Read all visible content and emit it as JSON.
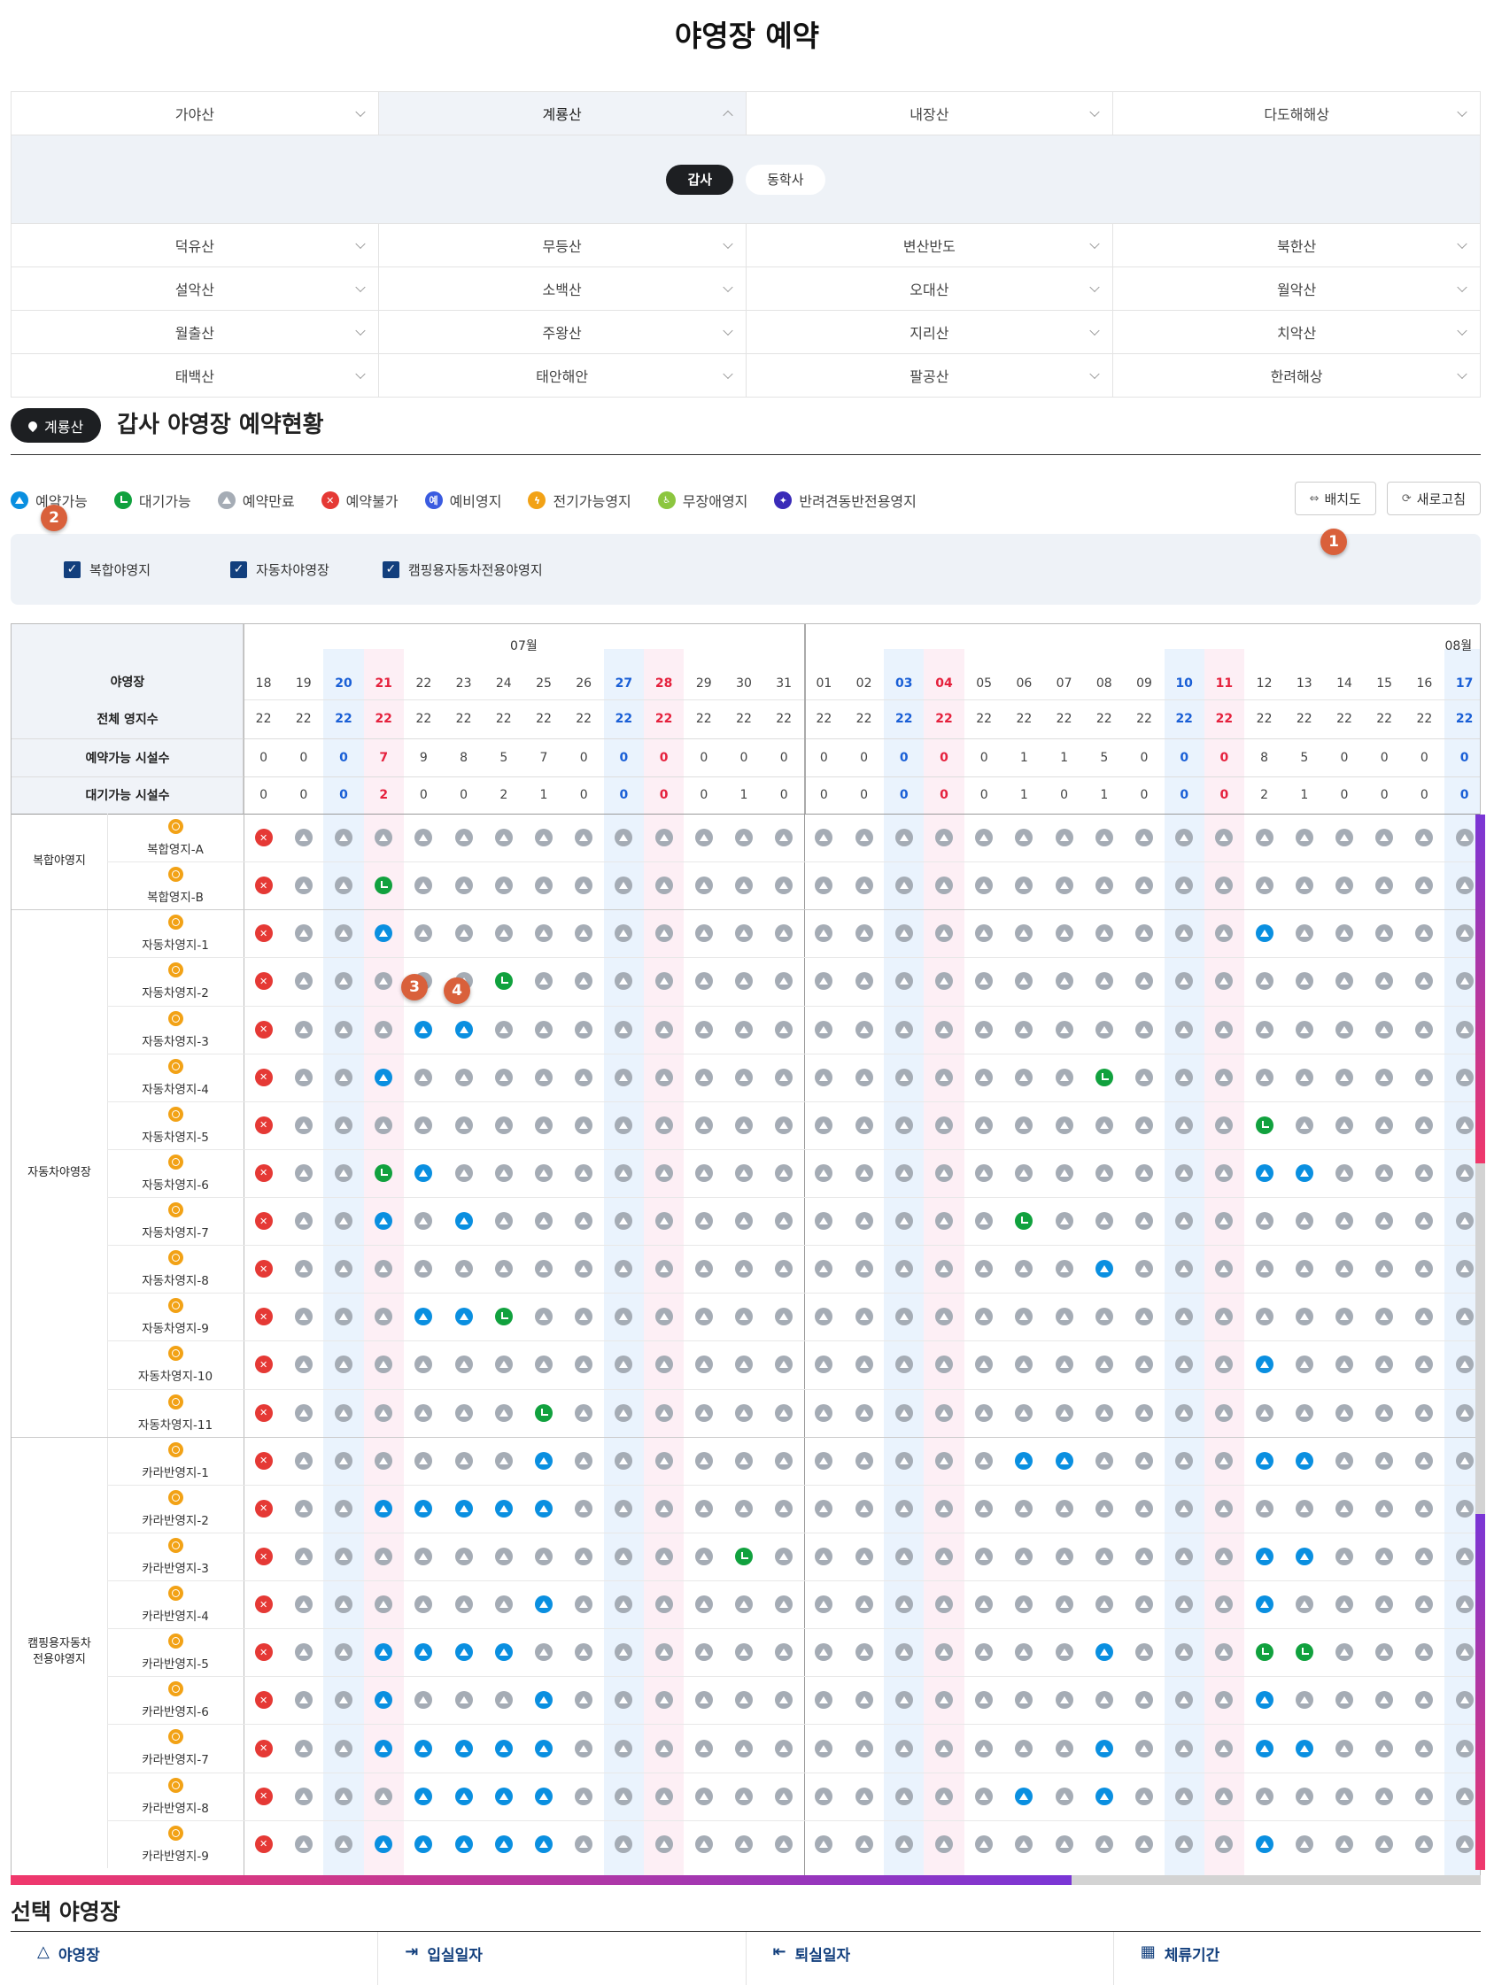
{
  "page_title": "야영장 예약",
  "mountains": [
    [
      "가야산",
      "계룡산",
      "내장산",
      "다도해해상"
    ],
    [
      "덕유산",
      "무등산",
      "변산반도",
      "북한산"
    ],
    [
      "설악산",
      "소백산",
      "오대산",
      "월악산"
    ],
    [
      "월출산",
      "주왕산",
      "지리산",
      "치악산"
    ],
    [
      "태백산",
      "태안해안",
      "팔공산",
      "한려해상"
    ]
  ],
  "active_mountain": "계룡산",
  "sub_sites": [
    "갑사",
    "동학사"
  ],
  "active_sub": "갑사",
  "section": {
    "location": "계룡산",
    "title": "갑사 야영장 예약현황"
  },
  "legend": [
    {
      "label": "예약가능",
      "icon": "available-triangle-icon",
      "color": "#0a8fe0"
    },
    {
      "label": "대기가능",
      "icon": "waiting-clock-icon",
      "color": "#11a13e"
    },
    {
      "label": "예약만료",
      "icon": "expired-triangle-icon",
      "color": "#a5acb5"
    },
    {
      "label": "예약불가",
      "icon": "unavailable-x-icon",
      "color": "#e53935"
    },
    {
      "label": "예비영지",
      "icon": "reserve-icon",
      "color": "#3a5be0",
      "glyph": "예"
    },
    {
      "label": "전기가능영지",
      "icon": "electric-icon",
      "color": "#f2a216"
    },
    {
      "label": "무장애영지",
      "icon": "accessible-icon",
      "color": "#8cc63f"
    },
    {
      "label": "반려견동반전용영지",
      "icon": "pet-icon",
      "color": "#3a2bb8"
    }
  ],
  "buttons": {
    "map": "배치도",
    "refresh": "새로고침"
  },
  "filters": [
    "복합야영지",
    "자동차야영장",
    "캠핑용자동차전용야영지"
  ],
  "markers": [
    "1",
    "2",
    "3",
    "4"
  ],
  "table": {
    "corner": "야영장",
    "months": [
      {
        "label": "07월",
        "span": 14
      },
      {
        "label": "08월",
        "span": 17
      }
    ],
    "days": [
      "18",
      "19",
      "20",
      "21",
      "22",
      "23",
      "24",
      "25",
      "26",
      "27",
      "28",
      "29",
      "30",
      "31",
      "01",
      "02",
      "03",
      "04",
      "05",
      "06",
      "07",
      "08",
      "09",
      "10",
      "11",
      "12",
      "13",
      "14",
      "15",
      "16",
      "17"
    ],
    "day_types": [
      "w",
      "w",
      "sat",
      "sun",
      "w",
      "w",
      "w",
      "w",
      "w",
      "sat",
      "sun",
      "w",
      "w",
      "w",
      "w",
      "w",
      "sat",
      "sun",
      "w",
      "w",
      "w",
      "w",
      "w",
      "sat",
      "sun",
      "w",
      "w",
      "w",
      "w",
      "w",
      "sat"
    ],
    "summary_rows": [
      {
        "label": "전체 영지수",
        "values": [
          "22",
          "22",
          "22",
          "22",
          "22",
          "22",
          "22",
          "22",
          "22",
          "22",
          "22",
          "22",
          "22",
          "22",
          "22",
          "22",
          "22",
          "22",
          "22",
          "22",
          "22",
          "22",
          "22",
          "22",
          "22",
          "22",
          "22",
          "22",
          "22",
          "22",
          "22"
        ]
      },
      {
        "label": "예약가능 시설수",
        "values": [
          "0",
          "0",
          "0",
          "7",
          "9",
          "8",
          "5",
          "7",
          "0",
          "0",
          "0",
          "0",
          "0",
          "0",
          "0",
          "0",
          "0",
          "0",
          "0",
          "1",
          "1",
          "5",
          "0",
          "0",
          "0",
          "8",
          "5",
          "0",
          "0",
          "0",
          "0"
        ]
      },
      {
        "label": "대기가능 시설수",
        "values": [
          "0",
          "0",
          "0",
          "2",
          "0",
          "0",
          "2",
          "1",
          "0",
          "0",
          "0",
          "0",
          "1",
          "0",
          "0",
          "0",
          "0",
          "0",
          "0",
          "1",
          "0",
          "1",
          "0",
          "0",
          "0",
          "2",
          "1",
          "0",
          "0",
          "0",
          "0"
        ]
      }
    ],
    "groups": [
      {
        "name": "복합야영지",
        "rows": [
          {
            "site": "복합영지-A",
            "cells": "XEEEEEEEEEEEEEEEEEEEEEEEEEEEEEE"
          },
          {
            "site": "복합영지-B",
            "cells": "XEEWEEEEEEEEEEEEEEEEEEEEEEEEEEE"
          }
        ]
      },
      {
        "name": "자동차야영장",
        "rows": [
          {
            "site": "자동차영지-1",
            "cells": "XEEAEEEEEEEEEEEEEEEEEEEEEAEEEEE"
          },
          {
            "site": "자동차영지-2",
            "cells": "XEEEEEWEEEEEEEEEEEEEEEEEEEEEEEE"
          },
          {
            "site": "자동차영지-3",
            "cells": "XEEEAAEEEEEEEEEEEEEEEEEEEEEEEEE"
          },
          {
            "site": "자동차영지-4",
            "cells": "XEEAEEEEEEEEEEEEEEEEEWEEEEEEEEE"
          },
          {
            "site": "자동차영지-5",
            "cells": "XEEEEEEEEEEEEEEEEEEEEEEEEWEEEEE"
          },
          {
            "site": "자동차영지-6",
            "cells": "XEEWAEEEEEEEEEEEEEEEEEEEEAAEEEE"
          },
          {
            "site": "자동차영지-7",
            "cells": "XEEAEAEEEEEEEEEEEEEWEEEEEEEEEEE"
          },
          {
            "site": "자동차영지-8",
            "cells": "XEEEEEEEEEEEEEEEEEEEEAEEEEEEEEE"
          },
          {
            "site": "자동차영지-9",
            "cells": "XEEEAAWEEEEEEEEEEEEEEEEEEEEEEEE"
          },
          {
            "site": "자동차영지-10",
            "cells": "XEEEEEEEEEEEEEEEEEEEEEEEEAEEEEE"
          },
          {
            "site": "자동차영지-11",
            "cells": "XEEEEEEWEEEEEEEEEEEEEEEEEEEEEEE"
          }
        ]
      },
      {
        "name": "캠핑용자동차 전용야영지",
        "rows": [
          {
            "site": "카라반영지-1",
            "cells": "XEEEEEEAEEEEEEEEEEEAAEEEEAAEEEE"
          },
          {
            "site": "카라반영지-2",
            "cells": "XEEAAAAAEEEEEEEEEEEEEEEEEEEEEEE"
          },
          {
            "site": "카라반영지-3",
            "cells": "XEEEEEEEEEEEWEEEEEEEEEEEEAAEEEE"
          },
          {
            "site": "카라반영지-4",
            "cells": "XEEEEEEAEEEEEEEEEEEEEEEEEAEEEEE"
          },
          {
            "site": "카라반영지-5",
            "cells": "XEEAAAAEEEEEEEEEEEEEEAEEEWWEEEE"
          },
          {
            "site": "카라반영지-6",
            "cells": "XEEAEEEAEEEEEEEEEEEEEEEEEAEEEEE"
          },
          {
            "site": "카라반영지-7",
            "cells": "XEEAAAAAEEEEEEEEEEEEEAEEEAAEEEE"
          },
          {
            "site": "카라반영지-8",
            "cells": "XEEEAAAAEEEEEEEEEEEAEAEEEEEEEEE"
          },
          {
            "site": "카라반영지-9",
            "cells": "XEEAAAAAEEEEEEEEEEEEEEEEEAEEEEE"
          }
        ]
      }
    ]
  },
  "colors": {
    "sat_bg": "#eaf3fd",
    "sun_bg": "#fdeff5",
    "sat_text": "#1a5fd6",
    "sun_text": "#e5213d",
    "header_bg": "#f0f3f8"
  },
  "selection": {
    "title": "선택 야영장",
    "columns": [
      "야영장",
      "입실일자",
      "퇴실일자",
      "체류기간"
    ]
  }
}
